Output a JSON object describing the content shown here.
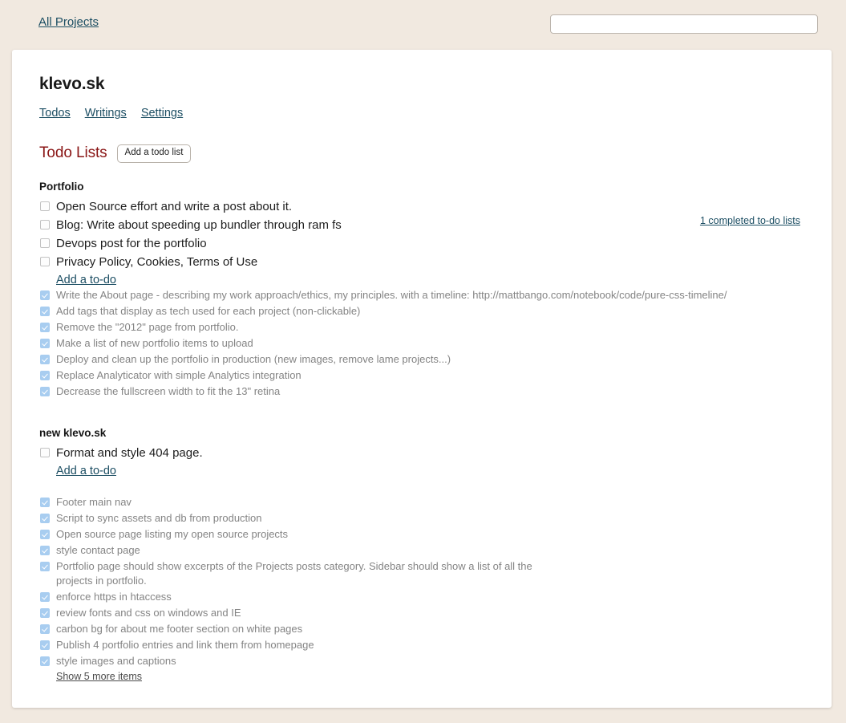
{
  "topbar": {
    "all_projects_label": "All Projects",
    "search_value": "",
    "search_placeholder": ""
  },
  "project": {
    "title": "klevo.sk",
    "tabs": [
      {
        "label": "Todos"
      },
      {
        "label": "Writings"
      },
      {
        "label": "Settings"
      }
    ]
  },
  "section": {
    "heading": "Todo Lists",
    "add_list_button": "Add a todo list",
    "completed_lists_link": "1 completed to-do lists"
  },
  "colors": {
    "page_bg": "#f1e9e0",
    "card_bg": "#ffffff",
    "link": "#1c4e63",
    "heading_accent": "#8a1616",
    "checkbox_done": "#a8cdf0",
    "done_text": "#848484"
  },
  "lists": [
    {
      "name": "Portfolio",
      "open_items": [
        {
          "text": "Open Source effort and write a post about it."
        },
        {
          "text": "Blog: Write about speeding up bundler through ram fs"
        },
        {
          "text": "Devops post for the portfolio"
        },
        {
          "text": "Privacy Policy, Cookies, Terms of Use"
        }
      ],
      "add_todo_label": "Add a to-do",
      "done_items": [
        {
          "text": "Write the About page - describing my work approach/ethics, my principles. with a timeline: http://mattbango.com/notebook/code/pure-css-timeline/"
        },
        {
          "text": "Add tags that display as tech used for each project (non-clickable)"
        },
        {
          "text": "Remove the \"2012\" page from portfolio."
        },
        {
          "text": "Make a list of new portfolio items to upload"
        },
        {
          "text": "Deploy and clean up the portfolio in production (new images, remove lame projects...)"
        },
        {
          "text": "Replace Analyticator with simple Analytics integration"
        },
        {
          "text": "Decrease the fullscreen width to fit the 13\" retina"
        }
      ],
      "show_more_label": ""
    },
    {
      "name": "new klevo.sk",
      "open_items": [
        {
          "text": "Format and style 404 page."
        }
      ],
      "add_todo_label": "Add a to-do",
      "done_items": [
        {
          "text": "Footer main nav"
        },
        {
          "text": "Script to sync assets and db from production"
        },
        {
          "text": "Open source page listing my open source projects"
        },
        {
          "text": "style contact page"
        },
        {
          "text": "Portfolio page should show excerpts of the Projects posts category. Sidebar should show a list of all the projects in portfolio."
        },
        {
          "text": "enforce https in htaccess"
        },
        {
          "text": "review fonts and css on windows and IE"
        },
        {
          "text": "carbon bg for about me footer section on white pages"
        },
        {
          "text": "Publish 4 portfolio entries and link them from homepage"
        },
        {
          "text": "style images and captions"
        }
      ],
      "show_more_label": "Show 5 more items"
    }
  ]
}
